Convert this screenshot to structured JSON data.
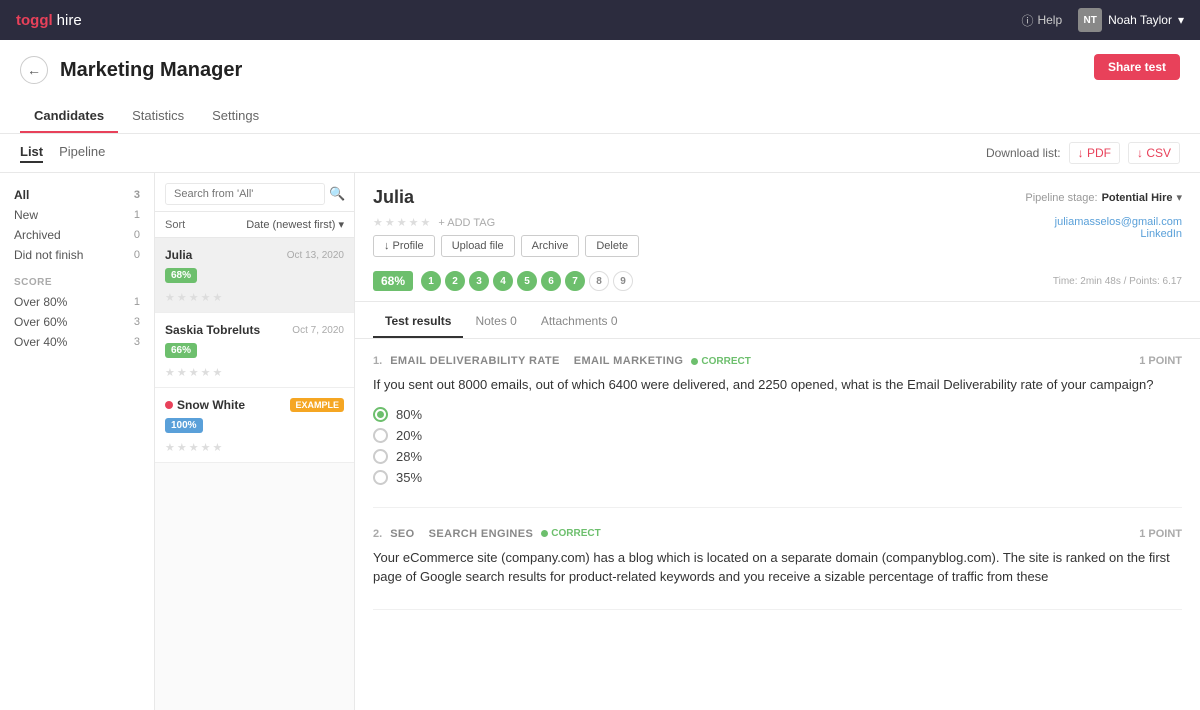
{
  "app": {
    "logo_toggl": "toggl",
    "logo_hire": "hire",
    "help_label": "Help",
    "user_initials": "NT",
    "user_name": "Noah Taylor",
    "chevron_icon": "▾"
  },
  "page": {
    "back_icon": "←",
    "title": "Marketing Manager",
    "tabs": [
      {
        "label": "Candidates",
        "active": true
      },
      {
        "label": "Statistics",
        "active": false
      },
      {
        "label": "Settings",
        "active": false
      }
    ],
    "share_test_label": "Share test"
  },
  "subheader": {
    "view_tabs": [
      {
        "label": "List",
        "active": true
      },
      {
        "label": "Pipeline",
        "active": false
      }
    ],
    "download_label": "Download list:",
    "pdf_label": "↓ PDF",
    "csv_label": "↓ CSV"
  },
  "sidebar": {
    "filters": [
      {
        "label": "All",
        "count": "3",
        "active": true
      },
      {
        "label": "New",
        "count": "1",
        "active": false
      },
      {
        "label": "Archived",
        "count": "0",
        "active": false
      },
      {
        "label": "Did not finish",
        "count": "0",
        "active": false
      }
    ],
    "score_header": "SCORE",
    "score_filters": [
      {
        "label": "Over 80%",
        "count": "1"
      },
      {
        "label": "Over 60%",
        "count": "3"
      },
      {
        "label": "Over 40%",
        "count": "3"
      }
    ]
  },
  "candidate_list": {
    "search_placeholder": "Search from 'All'",
    "sort_label": "Sort",
    "sort_value": "Date (newest first)",
    "sort_icon": "▾",
    "candidates": [
      {
        "name": "Julia",
        "date": "Oct 13, 2020",
        "score": "68%",
        "score_type": "green",
        "selected": true,
        "example": false,
        "red_dot": false
      },
      {
        "name": "Saskia Tobreluts",
        "date": "Oct 7, 2020",
        "score": "66%",
        "score_type": "green",
        "selected": false,
        "example": false,
        "red_dot": false
      },
      {
        "name": "Snow White",
        "date": "",
        "score": "100%",
        "score_type": "blue",
        "selected": false,
        "example": true,
        "example_label": "EXAMPLE",
        "red_dot": true
      }
    ]
  },
  "detail": {
    "name": "Julia",
    "pipeline_stage_label": "Pipeline stage:",
    "pipeline_stage_value": "Potential Hire",
    "email": "juliamasselos@gmail.com",
    "linkedin": "LinkedIn",
    "add_tag_label": "+ ADD TAG",
    "actions": [
      {
        "label": "↓ Profile",
        "icon": "download"
      },
      {
        "label": "Upload file"
      },
      {
        "label": "Archive"
      },
      {
        "label": "Delete"
      }
    ],
    "score": "68%",
    "question_dots": [
      {
        "number": "1",
        "state": "correct"
      },
      {
        "number": "2",
        "state": "correct"
      },
      {
        "number": "3",
        "state": "correct"
      },
      {
        "number": "4",
        "state": "correct"
      },
      {
        "number": "5",
        "state": "correct"
      },
      {
        "number": "6",
        "state": "correct"
      },
      {
        "number": "7",
        "state": "correct"
      },
      {
        "number": "8",
        "state": "neutral"
      },
      {
        "number": "9",
        "state": "neutral"
      }
    ],
    "time_points": "Time: 2min 48s / Points: 6.17",
    "tabs": [
      {
        "label": "Test results",
        "active": true
      },
      {
        "label": "Notes",
        "count": "0",
        "active": false
      },
      {
        "label": "Attachments",
        "count": "0",
        "active": false
      }
    ],
    "questions": [
      {
        "number": "1.",
        "category": "EMAIL DELIVERABILITY RATE",
        "subcategory": "EMAIL MARKETING",
        "correct": true,
        "correct_label": "CORRECT",
        "points": "1 POINT",
        "text": "If you sent out 8000 emails, out of which 6400 were delivered, and 2250 opened, what is the Email Deliverability rate of your campaign?",
        "options": [
          {
            "text": "80%",
            "selected": true
          },
          {
            "text": "20%",
            "selected": false
          },
          {
            "text": "28%",
            "selected": false
          },
          {
            "text": "35%",
            "selected": false
          }
        ]
      },
      {
        "number": "2.",
        "category": "SEO",
        "subcategory": "SEARCH ENGINES",
        "correct": true,
        "correct_label": "CORRECT",
        "points": "1 POINT",
        "text": "Your eCommerce site (company.com) has a blog which is located on a separate domain (companyblog.com). The site is ranked on the first page of Google search results for product-related keywords and you receive a sizable percentage of traffic from these",
        "options": []
      }
    ]
  }
}
